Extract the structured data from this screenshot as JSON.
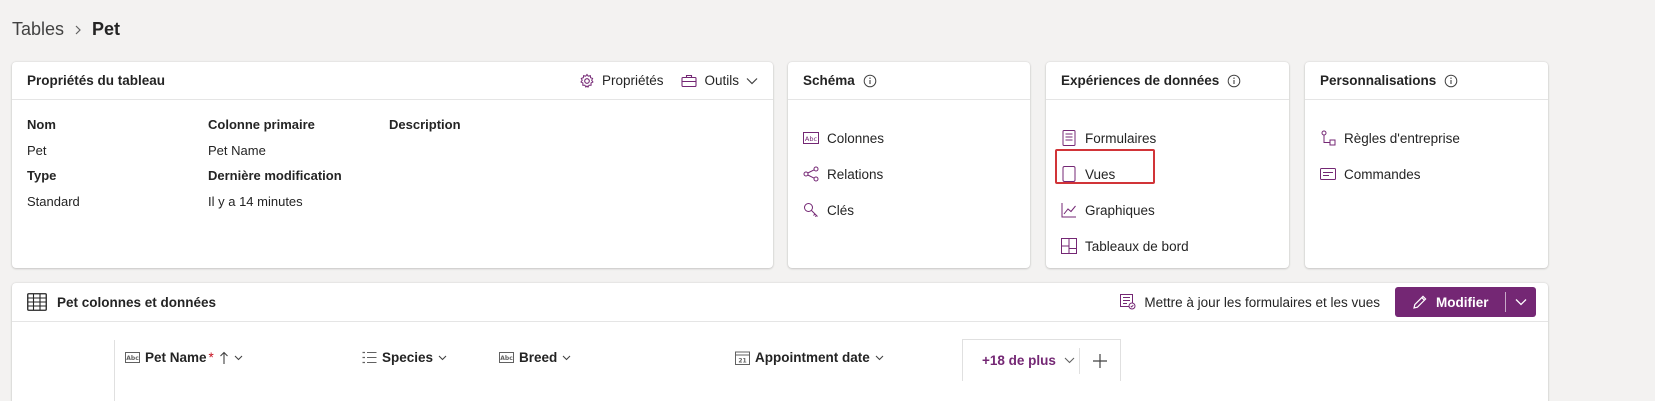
{
  "breadcrumb": {
    "root": "Tables",
    "current": "Pet"
  },
  "properties_card": {
    "title": "Propriétés du tableau",
    "properties_btn": "Propriétés",
    "tools_btn": "Outils",
    "nom_label": "Nom",
    "nom_value": "Pet",
    "type_label": "Type",
    "type_value": "Standard",
    "primary_label": "Colonne primaire",
    "primary_value": "Pet Name",
    "modified_label": "Dernière modification",
    "modified_value": "Il y a 14 minutes",
    "description_label": "Description"
  },
  "schema_card": {
    "title": "Schéma",
    "items": [
      "Colonnes",
      "Relations",
      "Clés"
    ]
  },
  "experiences_card": {
    "title": "Expériences de données",
    "items": [
      "Formulaires",
      "Vues",
      "Graphiques",
      "Tableaux de bord"
    ]
  },
  "personalisations_card": {
    "title": "Personnalisations",
    "items": [
      "Règles d'entreprise",
      "Commandes"
    ]
  },
  "table_card": {
    "title": "Pet colonnes et données",
    "update_link": "Mettre à jour les formulaires et les vues",
    "modify_btn": "Modifier",
    "columns": [
      "Pet Name",
      "Species",
      "Breed",
      "Appointment date"
    ],
    "required_marker": "*",
    "more_columns": "+18 de plus"
  },
  "colors": {
    "accent": "#742774",
    "highlight": "#d13438",
    "required": "#c50f1f"
  }
}
